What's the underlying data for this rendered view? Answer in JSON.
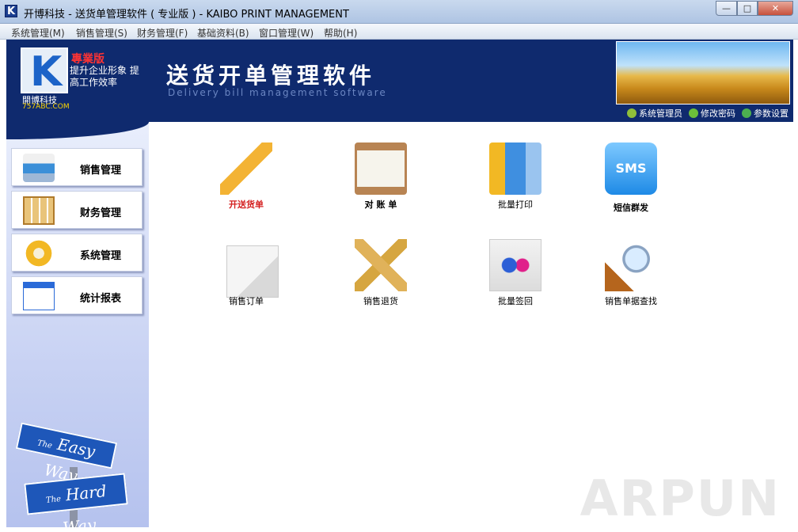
{
  "window": {
    "title": "开博科技 - 送货单管理软件 ( 专业版 ) - KAIBO PRINT MANAGEMENT",
    "app_icon_letter": "K",
    "minimize": "—",
    "maximize": "□",
    "close": "✕"
  },
  "menubar": [
    {
      "label": "系统管理(M)"
    },
    {
      "label": "销售管理(S)"
    },
    {
      "label": "财务管理(F)"
    },
    {
      "label": "基础资料(B)"
    },
    {
      "label": "窗口管理(W)"
    },
    {
      "label": "帮助(H)"
    }
  ],
  "banner": {
    "logo_letter": "K",
    "company": "開博科技",
    "website": "757ABC.COM",
    "edition": "專業版",
    "slogan": "提升企业形象 提高工作效率",
    "title": "送货开单管理软件",
    "subtitle": "Delivery bill management software",
    "links": [
      {
        "label": "系统管理员",
        "icon": "user-icon",
        "color": "#8fbf3a"
      },
      {
        "label": "修改密码",
        "icon": "pencil-icon",
        "color": "#6cbf3a"
      },
      {
        "label": "参数设置",
        "icon": "globe-icon",
        "color": "#4caf50"
      }
    ]
  },
  "sidebar": {
    "items": [
      {
        "label": "销售管理",
        "icon": "printer-icon"
      },
      {
        "label": "财务管理",
        "icon": "calendar-icon"
      },
      {
        "label": "系统管理",
        "icon": "gear-icon"
      },
      {
        "label": "统计报表",
        "icon": "bar-chart-icon"
      }
    ],
    "sign_easy": "Easy Way",
    "sign_easy_prefix": "The",
    "sign_hard": "Hard Way",
    "sign_hard_prefix": "The"
  },
  "tiles": [
    {
      "label": "开送货单",
      "icon": "pencil-icon"
    },
    {
      "label": "对 账 单",
      "icon": "clipboard-icon"
    },
    {
      "label": "批量打印",
      "icon": "binders-icon"
    },
    {
      "label": "短信群发",
      "icon": "sms-icon",
      "icon_text": "SMS"
    },
    {
      "label": "销售订单",
      "icon": "document-edit-icon"
    },
    {
      "label": "销售退货",
      "icon": "ruler-pencil-icon"
    },
    {
      "label": "批量签回",
      "icon": "dots-icon"
    },
    {
      "label": "销售单据查找",
      "icon": "magnifier-icon"
    }
  ],
  "watermark": "ARPUN"
}
